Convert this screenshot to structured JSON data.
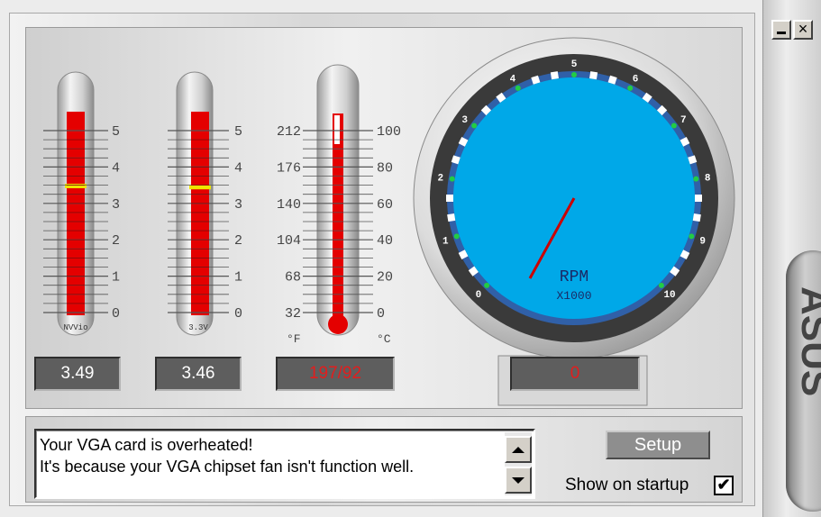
{
  "window": {
    "minimize_label": "_",
    "close_label": "×",
    "brand": "ASUS"
  },
  "voltage_meters": [
    {
      "caption": "NVVio",
      "reading": "3.49",
      "level": 3.49,
      "ticks": [
        "5",
        "4",
        "3",
        "2",
        "1",
        "0"
      ]
    },
    {
      "caption": "3.3V",
      "reading": "3.46",
      "level": 3.46,
      "ticks": [
        "5",
        "4",
        "3",
        "2",
        "1",
        "0"
      ]
    }
  ],
  "thermometer": {
    "reading": "197/92",
    "fahrenheit_ticks": [
      "212",
      "176",
      "140",
      "104",
      "68",
      "32"
    ],
    "celsius_ticks": [
      "100",
      "80",
      "60",
      "40",
      "20",
      "0"
    ],
    "unit_f": "°F",
    "unit_c": "°C",
    "fill_fraction": 1.0,
    "alarm_color": "#e31d1d"
  },
  "fan_gauge": {
    "reading": "0",
    "dial_numbers": [
      "0",
      "1",
      "2",
      "3",
      "4",
      "5",
      "6",
      "7",
      "8",
      "9",
      "10"
    ],
    "label": "RPM",
    "multiplier": "X1000",
    "dial_color": "#00a8e8"
  },
  "message": {
    "lines": [
      "Your VGA card is overheated!",
      "It's because your VGA chipset fan isn't function well."
    ]
  },
  "controls": {
    "setup_label": "Setup",
    "startup_label": "Show on startup",
    "startup_checked": true,
    "check_mark": "✔"
  }
}
